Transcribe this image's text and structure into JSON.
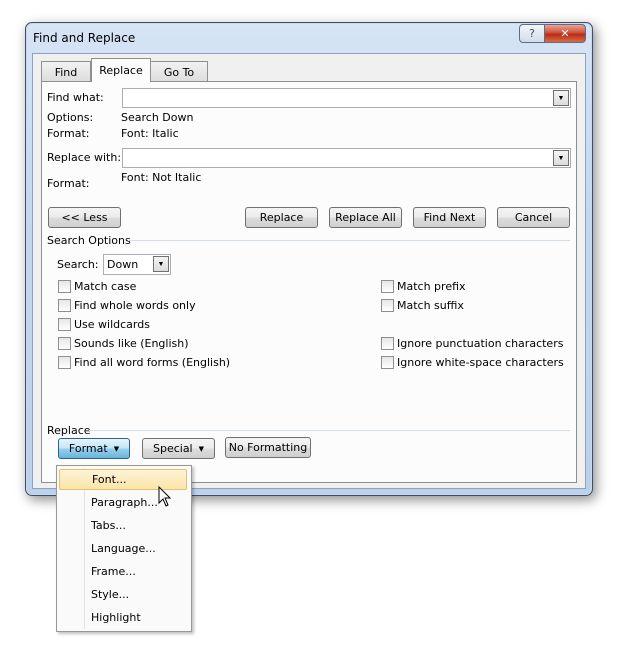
{
  "window": {
    "title": "Find and Replace",
    "help_glyph": "?",
    "close_glyph": "✕"
  },
  "tabs": [
    {
      "label": "Find"
    },
    {
      "label": "Replace"
    },
    {
      "label": "Go To"
    }
  ],
  "find": {
    "label": "Find what:",
    "value": "",
    "options_label": "Options:",
    "options_value": "Search Down",
    "format_label": "Format:",
    "format_value": "Font: Italic"
  },
  "replace": {
    "label": "Replace with:",
    "value": "",
    "format_label": "Format:",
    "format_value": "Font: Not Italic"
  },
  "buttons": {
    "less": "<< Less",
    "replace": "Replace",
    "replace_all": "Replace All",
    "find_next": "Find Next",
    "cancel": "Cancel"
  },
  "search_options": {
    "heading": "Search Options",
    "search_label": "Search:",
    "search_value": "Down",
    "left": [
      {
        "label": "Match case",
        "checked": false
      },
      {
        "label": "Find whole words only",
        "checked": false
      },
      {
        "label": "Use wildcards",
        "checked": false
      },
      {
        "label": "Sounds like (English)",
        "checked": false
      },
      {
        "label": "Find all word forms (English)",
        "checked": false
      }
    ],
    "right": [
      {
        "label": "Match prefix",
        "checked": false
      },
      {
        "label": "Match suffix",
        "checked": false
      },
      {
        "label": "Ignore punctuation characters",
        "checked": false
      },
      {
        "label": "Ignore white-space characters",
        "checked": false
      }
    ]
  },
  "replace_section": {
    "heading": "Replace",
    "format_btn": "Format",
    "special_btn": "Special",
    "no_formatting_btn": "No Formatting"
  },
  "format_menu": [
    {
      "label": "Font..."
    },
    {
      "label": "Paragraph..."
    },
    {
      "label": "Tabs..."
    },
    {
      "label": "Language..."
    },
    {
      "label": "Frame..."
    },
    {
      "label": "Style..."
    },
    {
      "label": "Highlight"
    }
  ]
}
